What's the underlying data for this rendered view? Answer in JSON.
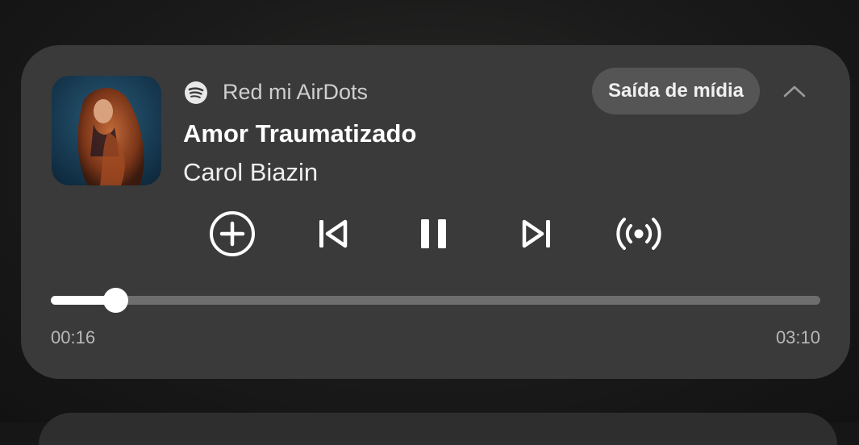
{
  "player": {
    "source_label": "Red mi AirDots",
    "source_icon": "spotify-icon",
    "output_label": "Saída de mídia",
    "title": "Amor Traumatizado",
    "artist": "Carol Biazin",
    "elapsed": "00:16",
    "total": "03:10",
    "progress_fraction": 0.084,
    "controls": [
      "add-circle-icon",
      "skip-previous-icon",
      "pause-icon",
      "skip-next-icon",
      "broadcast-icon"
    ],
    "accent_color": "#ffffff",
    "card_color": "#3a3a3a"
  }
}
